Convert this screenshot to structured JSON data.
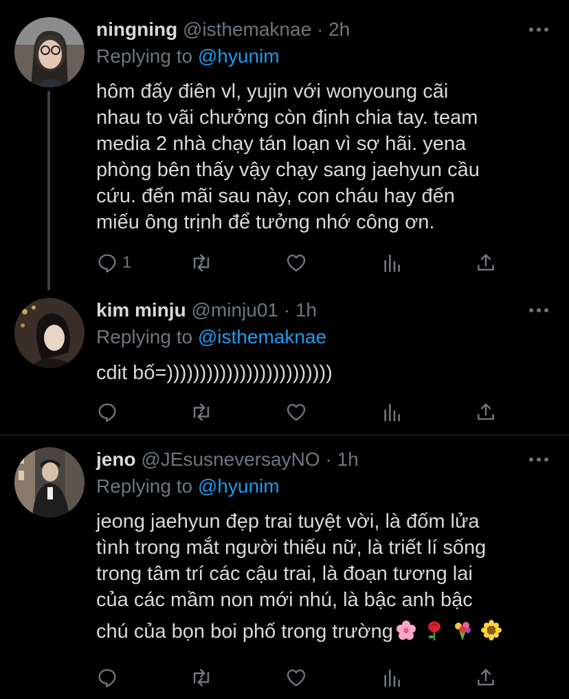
{
  "tweets": [
    {
      "name": "ningning",
      "handle": "@isthemaknae",
      "separator": "·",
      "time": "2h",
      "replying_prefix": "Replying to",
      "replying_to": "@hyunim",
      "lines": [
        "hôm đấy điên vl, yujin với wonyoung cãi",
        "nhau to vãi chưởng còn định chia tay. team",
        "media 2 nhà chạy tán loạn vì sợ hãi. yena",
        "phòng bên thấy vậy chạy sang jaehyun cầu",
        "cứu. đến mãi sau này, con cháu hay đến",
        "miếu ông trịnh để tưởng nhớ công ơn."
      ],
      "reply_count": "1",
      "avatar_color": "#6b5f5a"
    },
    {
      "name": "kim minju",
      "handle": "@minju01",
      "separator": "·",
      "time": "1h",
      "replying_prefix": "Replying to",
      "replying_to": "@isthemaknae",
      "lines": [
        "cdit bố=)))))))))))))))))))))))))"
      ],
      "reply_count": "",
      "avatar_color": "#3a2e28"
    },
    {
      "name": "jeno",
      "handle": "@JEsusneversayNO",
      "separator": "·",
      "time": "1h",
      "replying_prefix": "Replying to",
      "replying_to": "@hyunim",
      "lines": [
        "jeong jaehyun đẹp trai tuyệt vời, là đốm lửa",
        "tình trong mắt người thiếu nữ, là triết lí sống",
        "trong tâm trí các cậu trai, là đoạn tương lai",
        "của các mầm non mới nhú, là bậc anh bậc",
        "chú của bọn boi phố trong trường"
      ],
      "emojis": [
        "cherry-blossom",
        "rose",
        "bouquet",
        "sunflower"
      ],
      "reply_count": "",
      "avatar_color": "#4a4540"
    }
  ],
  "colors": {
    "background": "#000000",
    "text": "#d9d9d9",
    "muted": "#6e767d",
    "mention": "#1d9bf0",
    "divider": "#2f3336"
  },
  "icons": [
    "reply-icon",
    "retweet-icon",
    "like-icon",
    "analytics-icon",
    "share-icon",
    "more-icon"
  ]
}
